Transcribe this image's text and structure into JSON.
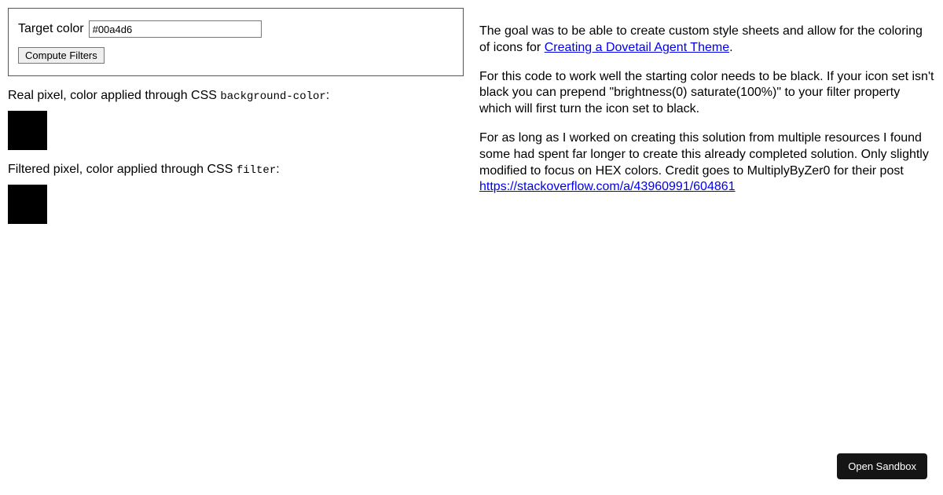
{
  "panel": {
    "target_label": "Target color",
    "target_value": "#00a4d6",
    "compute_label": "Compute Filters"
  },
  "sections": {
    "real_pixel_prefix": "Real pixel, color applied through CSS ",
    "real_pixel_code": "background-color",
    "filtered_pixel_prefix": "Filtered pixel, color applied through CSS ",
    "filtered_pixel_code": "filter",
    "colon": ":"
  },
  "swatch": {
    "real_color": "#000000",
    "filtered_color": "#000000"
  },
  "description": {
    "p1_prefix": "The goal was to be able to create custom style sheets and allow for the coloring of icons for ",
    "p1_link_text": "Creating a Dovetail Agent Theme",
    "p1_suffix": ".",
    "p2": "For this code to work well the starting color needs to be black. If your icon set isn't black you can prepend \"brightness(0) saturate(100%)\" to your filter property which will first turn the icon set to black.",
    "p3_prefix": "For as long as I worked on creating this solution from multiple resources I found some had spent far longer to create this already completed solution. Only slightly modified to focus on HEX colors. Credit goes to MultiplyByZer0 for their post ",
    "p3_link_text": "https://stackoverflow.com/a/43960991/604861"
  },
  "sandbox": {
    "label": "Open Sandbox"
  }
}
